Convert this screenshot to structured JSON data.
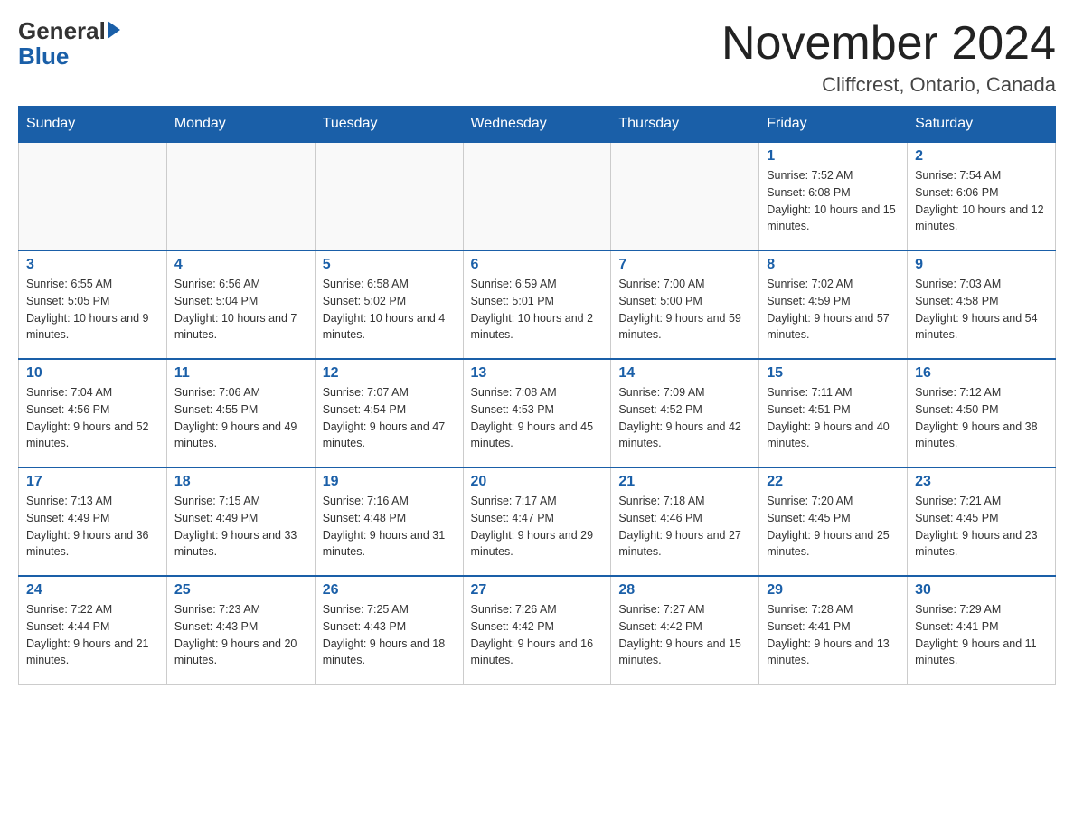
{
  "header": {
    "logo_general": "General",
    "logo_blue": "Blue",
    "month_title": "November 2024",
    "location": "Cliffcrest, Ontario, Canada"
  },
  "weekdays": [
    "Sunday",
    "Monday",
    "Tuesday",
    "Wednesday",
    "Thursday",
    "Friday",
    "Saturday"
  ],
  "weeks": [
    [
      {
        "day": "",
        "info": ""
      },
      {
        "day": "",
        "info": ""
      },
      {
        "day": "",
        "info": ""
      },
      {
        "day": "",
        "info": ""
      },
      {
        "day": "",
        "info": ""
      },
      {
        "day": "1",
        "info": "Sunrise: 7:52 AM\nSunset: 6:08 PM\nDaylight: 10 hours and 15 minutes."
      },
      {
        "day": "2",
        "info": "Sunrise: 7:54 AM\nSunset: 6:06 PM\nDaylight: 10 hours and 12 minutes."
      }
    ],
    [
      {
        "day": "3",
        "info": "Sunrise: 6:55 AM\nSunset: 5:05 PM\nDaylight: 10 hours and 9 minutes."
      },
      {
        "day": "4",
        "info": "Sunrise: 6:56 AM\nSunset: 5:04 PM\nDaylight: 10 hours and 7 minutes."
      },
      {
        "day": "5",
        "info": "Sunrise: 6:58 AM\nSunset: 5:02 PM\nDaylight: 10 hours and 4 minutes."
      },
      {
        "day": "6",
        "info": "Sunrise: 6:59 AM\nSunset: 5:01 PM\nDaylight: 10 hours and 2 minutes."
      },
      {
        "day": "7",
        "info": "Sunrise: 7:00 AM\nSunset: 5:00 PM\nDaylight: 9 hours and 59 minutes."
      },
      {
        "day": "8",
        "info": "Sunrise: 7:02 AM\nSunset: 4:59 PM\nDaylight: 9 hours and 57 minutes."
      },
      {
        "day": "9",
        "info": "Sunrise: 7:03 AM\nSunset: 4:58 PM\nDaylight: 9 hours and 54 minutes."
      }
    ],
    [
      {
        "day": "10",
        "info": "Sunrise: 7:04 AM\nSunset: 4:56 PM\nDaylight: 9 hours and 52 minutes."
      },
      {
        "day": "11",
        "info": "Sunrise: 7:06 AM\nSunset: 4:55 PM\nDaylight: 9 hours and 49 minutes."
      },
      {
        "day": "12",
        "info": "Sunrise: 7:07 AM\nSunset: 4:54 PM\nDaylight: 9 hours and 47 minutes."
      },
      {
        "day": "13",
        "info": "Sunrise: 7:08 AM\nSunset: 4:53 PM\nDaylight: 9 hours and 45 minutes."
      },
      {
        "day": "14",
        "info": "Sunrise: 7:09 AM\nSunset: 4:52 PM\nDaylight: 9 hours and 42 minutes."
      },
      {
        "day": "15",
        "info": "Sunrise: 7:11 AM\nSunset: 4:51 PM\nDaylight: 9 hours and 40 minutes."
      },
      {
        "day": "16",
        "info": "Sunrise: 7:12 AM\nSunset: 4:50 PM\nDaylight: 9 hours and 38 minutes."
      }
    ],
    [
      {
        "day": "17",
        "info": "Sunrise: 7:13 AM\nSunset: 4:49 PM\nDaylight: 9 hours and 36 minutes."
      },
      {
        "day": "18",
        "info": "Sunrise: 7:15 AM\nSunset: 4:49 PM\nDaylight: 9 hours and 33 minutes."
      },
      {
        "day": "19",
        "info": "Sunrise: 7:16 AM\nSunset: 4:48 PM\nDaylight: 9 hours and 31 minutes."
      },
      {
        "day": "20",
        "info": "Sunrise: 7:17 AM\nSunset: 4:47 PM\nDaylight: 9 hours and 29 minutes."
      },
      {
        "day": "21",
        "info": "Sunrise: 7:18 AM\nSunset: 4:46 PM\nDaylight: 9 hours and 27 minutes."
      },
      {
        "day": "22",
        "info": "Sunrise: 7:20 AM\nSunset: 4:45 PM\nDaylight: 9 hours and 25 minutes."
      },
      {
        "day": "23",
        "info": "Sunrise: 7:21 AM\nSunset: 4:45 PM\nDaylight: 9 hours and 23 minutes."
      }
    ],
    [
      {
        "day": "24",
        "info": "Sunrise: 7:22 AM\nSunset: 4:44 PM\nDaylight: 9 hours and 21 minutes."
      },
      {
        "day": "25",
        "info": "Sunrise: 7:23 AM\nSunset: 4:43 PM\nDaylight: 9 hours and 20 minutes."
      },
      {
        "day": "26",
        "info": "Sunrise: 7:25 AM\nSunset: 4:43 PM\nDaylight: 9 hours and 18 minutes."
      },
      {
        "day": "27",
        "info": "Sunrise: 7:26 AM\nSunset: 4:42 PM\nDaylight: 9 hours and 16 minutes."
      },
      {
        "day": "28",
        "info": "Sunrise: 7:27 AM\nSunset: 4:42 PM\nDaylight: 9 hours and 15 minutes."
      },
      {
        "day": "29",
        "info": "Sunrise: 7:28 AM\nSunset: 4:41 PM\nDaylight: 9 hours and 13 minutes."
      },
      {
        "day": "30",
        "info": "Sunrise: 7:29 AM\nSunset: 4:41 PM\nDaylight: 9 hours and 11 minutes."
      }
    ]
  ]
}
